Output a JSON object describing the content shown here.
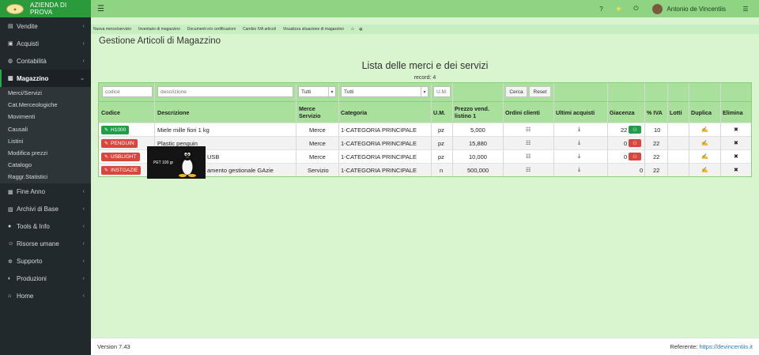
{
  "brand": {
    "name": "AZIENDA DI PROVA"
  },
  "topbar": {
    "help": "?",
    "user": "Antonio de Vincentiis"
  },
  "sidebar": {
    "items": [
      {
        "label": "Vendite",
        "icon": "invoice-icon"
      },
      {
        "label": "Acquisti",
        "icon": "cart-icon"
      },
      {
        "label": "Contabilità",
        "icon": "chat-icon"
      },
      {
        "label": "Magazzino",
        "icon": "warehouse-icon",
        "active": true
      },
      {
        "label": "Fine Anno",
        "icon": "book-icon"
      },
      {
        "label": "Archivi di Base",
        "icon": "archive-icon"
      },
      {
        "label": "Tools & Info",
        "icon": "tools-icon"
      },
      {
        "label": "Risorse umane",
        "icon": "people-icon"
      },
      {
        "label": "Supporto",
        "icon": "gear-icon"
      },
      {
        "label": "Produzioni",
        "icon": "production-icon"
      },
      {
        "label": "Home",
        "icon": "home-icon"
      }
    ],
    "submenu": [
      "Merci/Servizi",
      "Cat.Merceologiche",
      "Movimenti",
      "Causali",
      "Listini",
      "Modifica prezzi",
      "Catalogo",
      "Raggr.Statistici"
    ]
  },
  "subnav": [
    "Nuova merce/servizio",
    "Inventario di magazzino",
    "Documenti e/o certificazioni",
    "Cambio IVA articoli",
    "Visualizza situazione di magazzino"
  ],
  "page": {
    "title": "Gestione Articoli di Magazzino",
    "list_title": "Lista delle merci e dei servizi",
    "record_count": "record: 4"
  },
  "filters": {
    "codice_placeholder": "codice",
    "descrizione_placeholder": "descrizione",
    "tipo_value": "Tutti",
    "categoria_value": "Tutti",
    "um_placeholder": "U.M.",
    "search_label": "Cerca",
    "reset_label": "Reset"
  },
  "columns": {
    "codice": "Codice",
    "descrizione": "Descrizione",
    "merce_servizio_1": "Merce",
    "merce_servizio_2": "Servizio",
    "categoria": "Categoria",
    "um": "U.M.",
    "prezzo_1": "Prezzo vend.",
    "prezzo_2": "listino 1",
    "ordini": "Ordini clienti",
    "acquisti": "Ultimi acquisti",
    "giacenza": "Giacenza",
    "iva": "% IVA",
    "lotti": "Lotti",
    "duplica": "Duplica",
    "elimina": "Elimina"
  },
  "rows": [
    {
      "codice": "H1000",
      "codice_color": "green",
      "descrizione": "Miele mille fiori 1 kg",
      "tipo": "Merce",
      "categoria": "1-CATEGORIA PRINCIPALE",
      "um": "pz",
      "prezzo": "5,000",
      "giacenza": "22",
      "giacenza_color": "green",
      "iva": "10"
    },
    {
      "codice": "PENGUIN",
      "codice_color": "red",
      "descrizione": "Plastic penguin",
      "tipo": "Merce",
      "categoria": "1-CATEGORIA PRINCIPALE",
      "um": "pz",
      "prezzo": "15,880",
      "giacenza": "0",
      "giacenza_color": "red",
      "iva": "22"
    },
    {
      "codice": "USBLIGHT",
      "codice_color": "red",
      "descrizione": "USB",
      "tipo": "Merce",
      "categoria": "1-CATEGORIA PRINCIPALE",
      "um": "pz",
      "prezzo": "10,000",
      "giacenza": "0",
      "giacenza_color": "red",
      "iva": "22"
    },
    {
      "codice": "INSTGAZIE",
      "codice_color": "red",
      "descrizione": "amento gestionale GAzie",
      "tipo": "Servizio",
      "categoria": "1-CATEGORIA PRINCIPALE",
      "um": "n",
      "prezzo": "500,000",
      "giacenza": "0",
      "giacenza_color": "none",
      "iva": "22"
    }
  ],
  "tooltip": {
    "text": "PET 100 gr"
  },
  "footer": {
    "version": "Version 7.43",
    "referente_label": "Referente:",
    "referente_link": "https://devincentiis.it"
  },
  "colors": {
    "sidebar": "#22292d",
    "brand": "#2a9a3c",
    "topbar": "#8fd483",
    "page": "#d9f5cf",
    "header": "#a8e09c",
    "green_badge": "#1f9d4a",
    "red_badge": "#d9463f"
  }
}
